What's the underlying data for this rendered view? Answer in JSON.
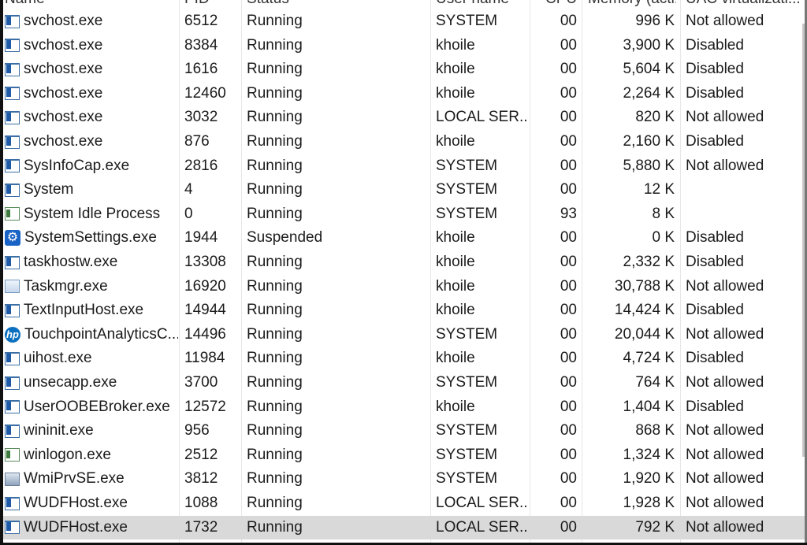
{
  "columns": {
    "name": "Name",
    "pid": "PID",
    "status": "Status",
    "user": "User name",
    "cpu": "CPU",
    "memory": "Memory (acti...",
    "uac": "UAC virtualizati..."
  },
  "rows": [
    {
      "icon": "window",
      "name": "svchost.exe",
      "pid": "6512",
      "status": "Running",
      "user": "SYSTEM",
      "cpu": "00",
      "memory": "996 K",
      "uac": "Not allowed"
    },
    {
      "icon": "window",
      "name": "svchost.exe",
      "pid": "8384",
      "status": "Running",
      "user": "khoile",
      "cpu": "00",
      "memory": "3,900 K",
      "uac": "Disabled"
    },
    {
      "icon": "window",
      "name": "svchost.exe",
      "pid": "1616",
      "status": "Running",
      "user": "khoile",
      "cpu": "00",
      "memory": "5,604 K",
      "uac": "Disabled"
    },
    {
      "icon": "window",
      "name": "svchost.exe",
      "pid": "12460",
      "status": "Running",
      "user": "khoile",
      "cpu": "00",
      "memory": "2,264 K",
      "uac": "Disabled"
    },
    {
      "icon": "window",
      "name": "svchost.exe",
      "pid": "3032",
      "status": "Running",
      "user": "LOCAL SER...",
      "cpu": "00",
      "memory": "820 K",
      "uac": "Not allowed"
    },
    {
      "icon": "window",
      "name": "svchost.exe",
      "pid": "876",
      "status": "Running",
      "user": "khoile",
      "cpu": "00",
      "memory": "2,160 K",
      "uac": "Disabled"
    },
    {
      "icon": "window",
      "name": "SysInfoCap.exe",
      "pid": "2816",
      "status": "Running",
      "user": "SYSTEM",
      "cpu": "00",
      "memory": "5,880 K",
      "uac": "Not allowed"
    },
    {
      "icon": "window",
      "name": "System",
      "pid": "4",
      "status": "Running",
      "user": "SYSTEM",
      "cpu": "00",
      "memory": "12 K",
      "uac": ""
    },
    {
      "icon": "green",
      "name": "System Idle Process",
      "pid": "0",
      "status": "Running",
      "user": "SYSTEM",
      "cpu": "93",
      "memory": "8 K",
      "uac": ""
    },
    {
      "icon": "gear",
      "name": "SystemSettings.exe",
      "pid": "1944",
      "status": "Suspended",
      "user": "khoile",
      "cpu": "00",
      "memory": "0 K",
      "uac": "Disabled"
    },
    {
      "icon": "window",
      "name": "taskhostw.exe",
      "pid": "13308",
      "status": "Running",
      "user": "khoile",
      "cpu": "00",
      "memory": "2,332 K",
      "uac": "Disabled"
    },
    {
      "icon": "taskmgr",
      "name": "Taskmgr.exe",
      "pid": "16920",
      "status": "Running",
      "user": "khoile",
      "cpu": "00",
      "memory": "30,788 K",
      "uac": "Not allowed"
    },
    {
      "icon": "window",
      "name": "TextInputHost.exe",
      "pid": "14944",
      "status": "Running",
      "user": "khoile",
      "cpu": "00",
      "memory": "14,424 K",
      "uac": "Disabled"
    },
    {
      "icon": "hp",
      "name": "TouchpointAnalyticsC...",
      "pid": "14496",
      "status": "Running",
      "user": "SYSTEM",
      "cpu": "00",
      "memory": "20,044 K",
      "uac": "Not allowed"
    },
    {
      "icon": "window",
      "name": "uihost.exe",
      "pid": "11984",
      "status": "Running",
      "user": "khoile",
      "cpu": "00",
      "memory": "4,724 K",
      "uac": "Disabled"
    },
    {
      "icon": "window",
      "name": "unsecapp.exe",
      "pid": "3700",
      "status": "Running",
      "user": "SYSTEM",
      "cpu": "00",
      "memory": "764 K",
      "uac": "Not allowed"
    },
    {
      "icon": "window",
      "name": "UserOOBEBroker.exe",
      "pid": "12572",
      "status": "Running",
      "user": "khoile",
      "cpu": "00",
      "memory": "1,404 K",
      "uac": "Disabled"
    },
    {
      "icon": "window",
      "name": "wininit.exe",
      "pid": "956",
      "status": "Running",
      "user": "SYSTEM",
      "cpu": "00",
      "memory": "868 K",
      "uac": "Not allowed"
    },
    {
      "icon": "green",
      "name": "winlogon.exe",
      "pid": "2512",
      "status": "Running",
      "user": "SYSTEM",
      "cpu": "00",
      "memory": "1,324 K",
      "uac": "Not allowed"
    },
    {
      "icon": "wmi",
      "name": "WmiPrvSE.exe",
      "pid": "3812",
      "status": "Running",
      "user": "SYSTEM",
      "cpu": "00",
      "memory": "1,920 K",
      "uac": "Not allowed"
    },
    {
      "icon": "window",
      "name": "WUDFHost.exe",
      "pid": "1088",
      "status": "Running",
      "user": "LOCAL SER...",
      "cpu": "00",
      "memory": "1,928 K",
      "uac": "Not allowed"
    },
    {
      "icon": "window",
      "name": "WUDFHost.exe",
      "pid": "1732",
      "status": "Running",
      "user": "LOCAL SER...",
      "cpu": "00",
      "memory": "792 K",
      "uac": "Not allowed",
      "selected": true
    }
  ]
}
